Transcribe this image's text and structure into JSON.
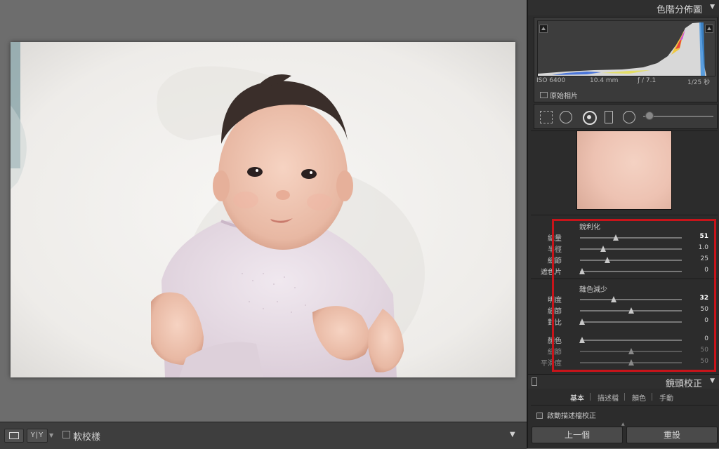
{
  "histogram": {
    "title": "色階分佈圖",
    "iso": "ISO 6400",
    "focal": "10.4 mm",
    "aperture": "ƒ / 7.1",
    "shutter": "1/25 秒",
    "original_photo_label": "原始相片"
  },
  "tools": [
    "grid-overlay-icon",
    "crop-icon",
    "spot-removal-icon",
    "graduated-filter-icon",
    "radial-filter-icon"
  ],
  "sharpening": {
    "title": "銳利化",
    "rows": [
      {
        "label": "總量",
        "value": "51",
        "level": 0.35,
        "bold": true,
        "dim": false
      },
      {
        "label": "半徑",
        "value": "1.0",
        "level": 0.23,
        "bold": false,
        "dim": false
      },
      {
        "label": "細節",
        "value": "25",
        "level": 0.27,
        "bold": false,
        "dim": false
      },
      {
        "label": "遮色片",
        "value": "0",
        "level": 0.02,
        "bold": false,
        "dim": false
      }
    ]
  },
  "noise_reduction": {
    "title": "雜色減少",
    "rows": [
      {
        "label": "明度",
        "value": "32",
        "level": 0.33,
        "bold": true,
        "dim": false
      },
      {
        "label": "細節",
        "value": "50",
        "level": 0.5,
        "bold": false,
        "dim": false
      },
      {
        "label": "對比",
        "value": "0",
        "level": 0.02,
        "bold": false,
        "dim": false
      },
      {
        "label": "顏色",
        "value": "0",
        "level": 0.02,
        "bold": false,
        "dim": false
      },
      {
        "label": "細節",
        "value": "50",
        "level": 0.5,
        "bold": false,
        "dim": true
      },
      {
        "label": "平滑度",
        "value": "50",
        "level": 0.5,
        "bold": false,
        "dim": true
      }
    ]
  },
  "lens": {
    "title": "鏡頭校正",
    "tabs": [
      "基本",
      "描述檔",
      "顏色",
      "手動"
    ],
    "active_tab": "基本",
    "enable_profile_label": "啟動描述檔校正"
  },
  "footer": {
    "prev_label": "上一個",
    "reset_label": "重設"
  },
  "toolbar": {
    "view_yy": "Y|Y",
    "soft_proof_label": "軟校樣"
  },
  "colors": {
    "highlight": "#c8141a",
    "panel_bg": "#2c2c2c",
    "viewport_bg": "#6d6d6d"
  }
}
